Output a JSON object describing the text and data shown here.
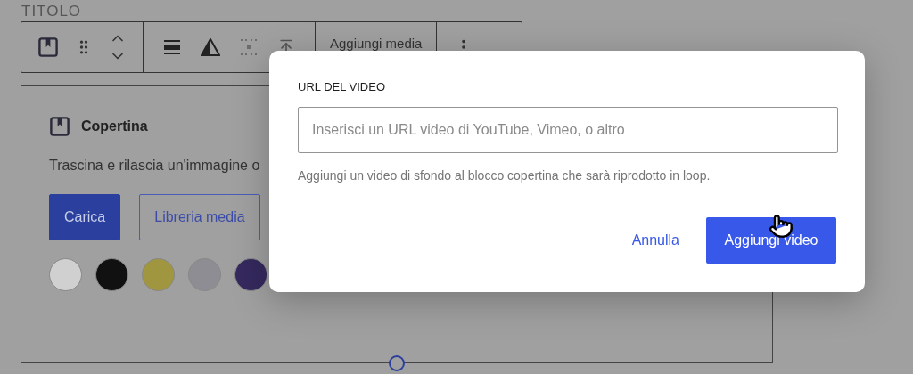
{
  "editor": {
    "block_label": "TITOLO",
    "toolbar": {
      "media_button": "Aggiungi media"
    },
    "cover_block": {
      "title": "Copertina",
      "instructions": "Trascina e rilascia un'immagine o",
      "buttons": [
        {
          "label": "Carica",
          "kind": "primary"
        },
        {
          "label": "Libreria media",
          "kind": "secondary"
        }
      ],
      "swatches": [
        {
          "color": "#d0d0d0"
        },
        {
          "color": "#111111"
        },
        {
          "color": "#a09640"
        },
        {
          "color": "#8f8d94"
        },
        {
          "color": "#35295e"
        }
      ]
    }
  },
  "dialog": {
    "label": "URL DEL VIDEO",
    "placeholder": "Inserisci un URL video di YouTube, Vimeo, o altro",
    "help": "Aggiungi un video di sfondo al blocco copertina che sarà riprodotto in loop.",
    "buttons": [
      {
        "label": "Annulla",
        "kind": "link"
      },
      {
        "label": "Aggiungi video",
        "kind": "primary"
      }
    ]
  }
}
